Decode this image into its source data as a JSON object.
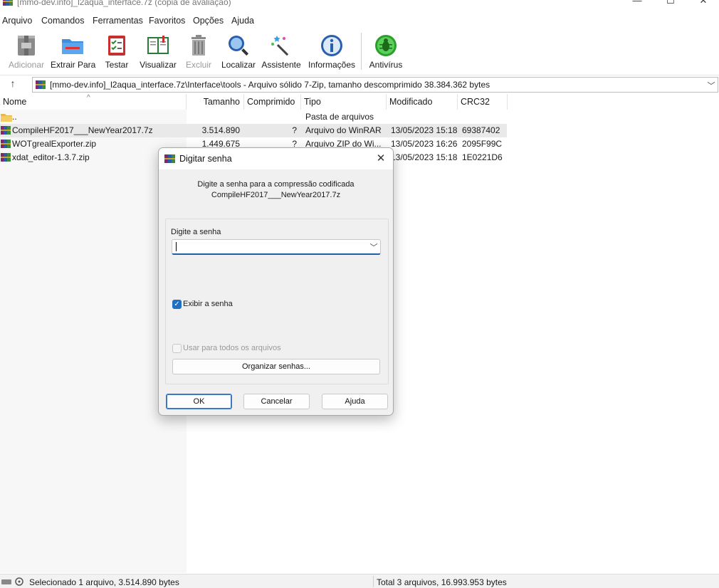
{
  "window": {
    "title": "[mmo-dev.info]_l2aqua_interface.7z (cópia de avaliação)",
    "minimize_glyph": "—",
    "maximize_glyph": "☐",
    "close_glyph": "✕"
  },
  "menu": [
    "Arquivo",
    "Comandos",
    "Ferramentas",
    "Favoritos",
    "Opções",
    "Ajuda"
  ],
  "toolbar": [
    {
      "label": "Adicionar",
      "icon": "add-archive-icon",
      "enabled": false
    },
    {
      "label": "Extrair Para",
      "icon": "extract-folder-icon",
      "enabled": true
    },
    {
      "label": "Testar",
      "icon": "test-checklist-icon",
      "enabled": true
    },
    {
      "label": "Visualizar",
      "icon": "view-book-icon",
      "enabled": true
    },
    {
      "label": "Excluir",
      "icon": "trash-icon",
      "enabled": false
    },
    {
      "label": "Localizar",
      "icon": "magnifier-icon",
      "enabled": true
    },
    {
      "label": "Assistente",
      "icon": "wizard-wand-icon",
      "enabled": true
    },
    {
      "label": "Informações",
      "icon": "info-icon",
      "enabled": true
    },
    {
      "label": "Antivírus",
      "icon": "antivirus-bug-icon",
      "enabled": true
    }
  ],
  "address": {
    "path": "[mmo-dev.info]_l2aqua_interface.7z\\Interface\\tools - Arquivo sólido 7-Zip, tamanho descomprimido 38.384.362 bytes",
    "up_glyph": "↑",
    "dropdown_glyph": "﹀"
  },
  "columns": [
    "Nome",
    "Tamanho",
    "Comprimido",
    "Tipo",
    "Modificado",
    "CRC32"
  ],
  "sort_glyph": "^",
  "files": [
    {
      "name": "..",
      "size": "",
      "packed": "",
      "type": "Pasta de arquivos",
      "modified": "",
      "crc": "",
      "kind": "folder",
      "selected": false
    },
    {
      "name": "CompileHF2017___NewYear2017.7z",
      "size": "3.514.890",
      "packed": "?",
      "type": "Arquivo do WinRAR",
      "modified": "13/05/2023 15:18",
      "crc": "69387402",
      "kind": "archive",
      "selected": true
    },
    {
      "name": "WOTgrealExporter.zip",
      "size": "1.449.675",
      "packed": "?",
      "type": "Arquivo ZIP do Wi...",
      "modified": "13/05/2023 16:26",
      "crc": "2095F99C",
      "kind": "archive",
      "selected": false
    },
    {
      "name": "xdat_editor-1.3.7.zip",
      "size": "",
      "packed": "",
      "type": "",
      "modified": "13/05/2023 15:18",
      "crc": "1E0221D6",
      "kind": "archive",
      "selected": false
    }
  ],
  "status": {
    "left": "Selecionado 1 arquivo, 3.514.890 bytes",
    "right": "Total 3 arquivos, 16.993.953 bytes"
  },
  "dialog": {
    "title": "Digitar senha",
    "close_glyph": "✕",
    "message_line1": "Digite a senha para a compressão codificada",
    "message_line2": "CompileHF2017___NewYear2017.7z",
    "password_label": "Digite a senha",
    "password_value": "",
    "dropdown_glyph": "﹀",
    "show_password_label": "Exibir a senha",
    "show_password_checked": true,
    "check_glyph": "✓",
    "use_for_all_label": "Usar para todos os arquivos",
    "use_for_all_checked": false,
    "organize_button": "Organizar senhas...",
    "ok_button": "OK",
    "cancel_button": "Cancelar",
    "help_button": "Ajuda"
  },
  "colors": {
    "accent": "#1f6fc5",
    "selection": "#e9e9e9",
    "dialog_bg": "#f0f0f0"
  }
}
